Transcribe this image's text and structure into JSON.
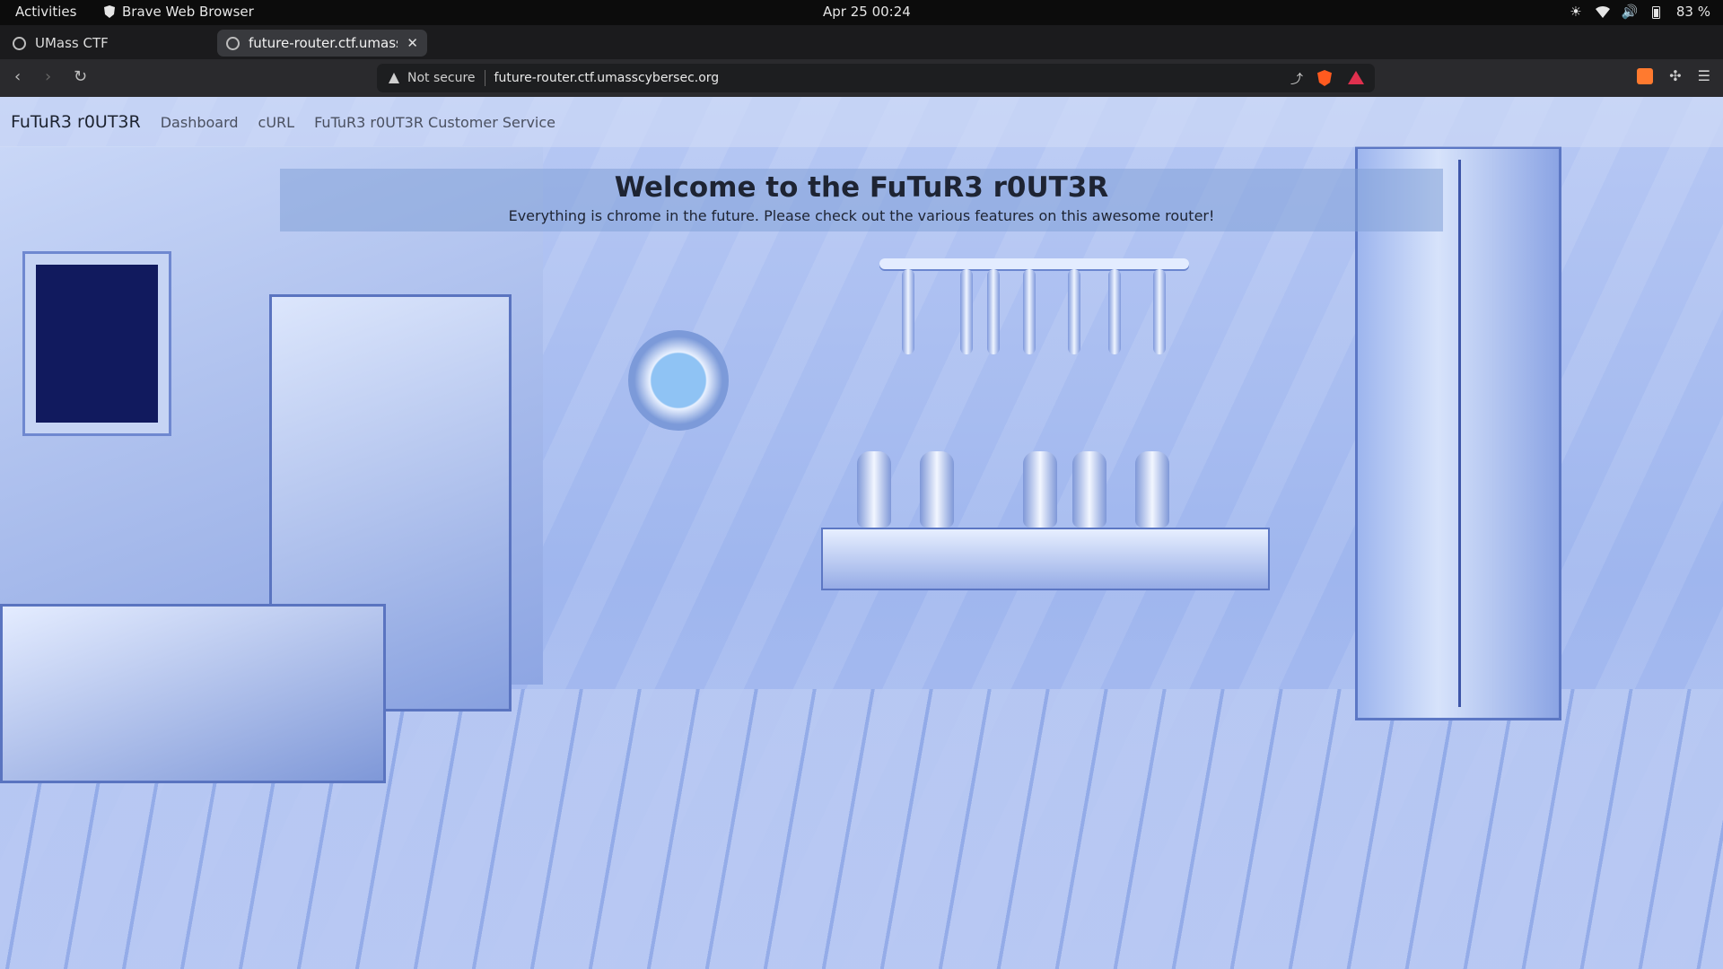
{
  "system_bar": {
    "activities": "Activities",
    "app_name": "Brave Web Browser",
    "clock": "Apr 25  00:24",
    "battery": "83 %"
  },
  "browser": {
    "tabs": [
      {
        "label": "UMass CTF",
        "active": false
      },
      {
        "label": "future-router.ctf.umassc",
        "active": true
      }
    ],
    "new_tab": "+",
    "address_bar": {
      "security_label": "Not secure",
      "url": "future-router.ctf.umasscybersec.org"
    }
  },
  "page": {
    "brand": "FuTuR3 r0UT3R",
    "nav_links": [
      "Dashboard",
      "cURL",
      "FuTuR3 r0UT3R Customer Service"
    ],
    "hero_title": "Welcome to the FuTuR3 r0UT3R",
    "hero_subtitle": "Everything is chrome in the future. Please check out the various features on this awesome router!"
  },
  "colors": {
    "accent": "#ff5a1f",
    "background_tint": "#a9bdf0"
  }
}
